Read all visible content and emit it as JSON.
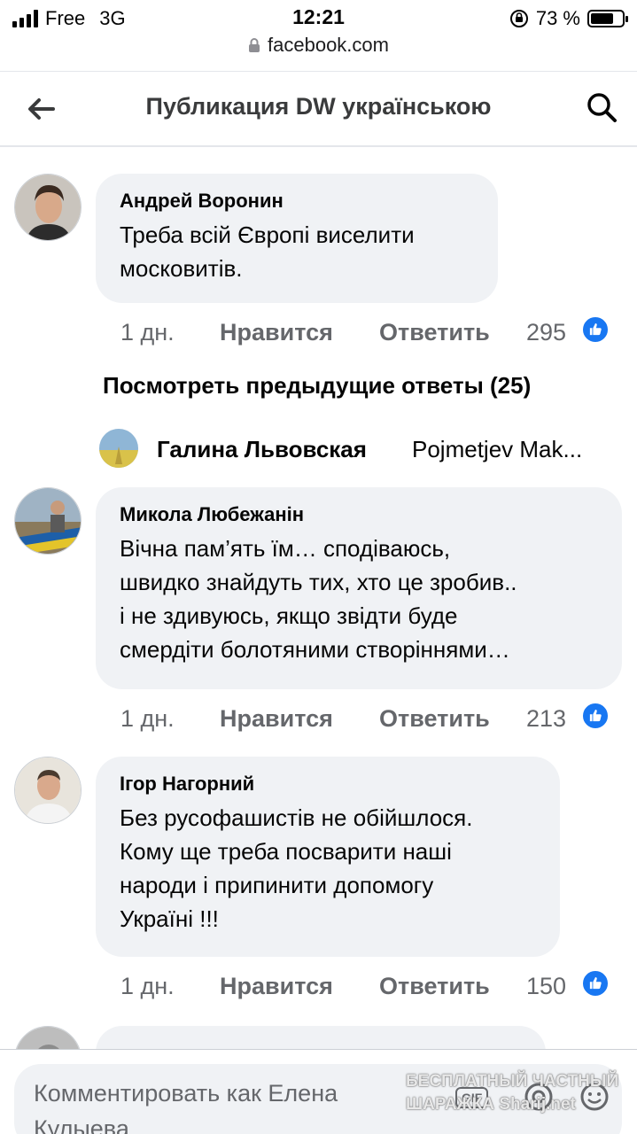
{
  "status_bar": {
    "carrier": "Free",
    "network": "3G",
    "time": "12:21",
    "battery": "73 %",
    "battery_level": 0.73,
    "url": "facebook.com"
  },
  "header": {
    "title": "Публикация DW українською",
    "back_icon": "arrow-left-icon",
    "search_icon": "search-icon"
  },
  "comments": [
    {
      "author": "Андрей Воронин",
      "text": "Треба всій Європі виселити\nмосковитів.",
      "time": "1 дн.",
      "like_label": "Нравится",
      "reply_label": "Ответить",
      "likes": "295"
    },
    {
      "author": "Микола Любежанін",
      "text": "Вічна пам’ять їм… сподіваюсь,\nшвидко знайдуть тих, хто це зробив..\nі не здивуюсь, якщо звідти буде\nсмердіти болотяними створіннями…",
      "time": "1 дн.",
      "like_label": "Нравится",
      "reply_label": "Ответить",
      "likes": "213"
    },
    {
      "author": "Ігор Нагорний",
      "text": "Без русофашистів не обійшлося.\nКому ще треба посварити наші\nнароди і припинити допомогу\nУкраїні !!!",
      "time": "1 дн.",
      "like_label": "Нравится",
      "reply_label": "Ответить",
      "likes": "150"
    }
  ],
  "previous_replies": "Посмотреть предыдущие ответы (25)",
  "reply_preview": {
    "author": "Галина Львовская",
    "text": "Pojmetjev Mak..."
  },
  "composer": {
    "placeholder": "Комментировать как Елена Кулыева",
    "gif_label": "GIF"
  },
  "watermark": {
    "line1": "БЕСПЛАТНЫЙ ЧАСТНЫЙ",
    "line2": "ШАРАЖКА Sharij.net"
  },
  "colors": {
    "accent": "#1877f2",
    "bubble": "#f0f2f5",
    "secondary_text": "#65676b"
  }
}
